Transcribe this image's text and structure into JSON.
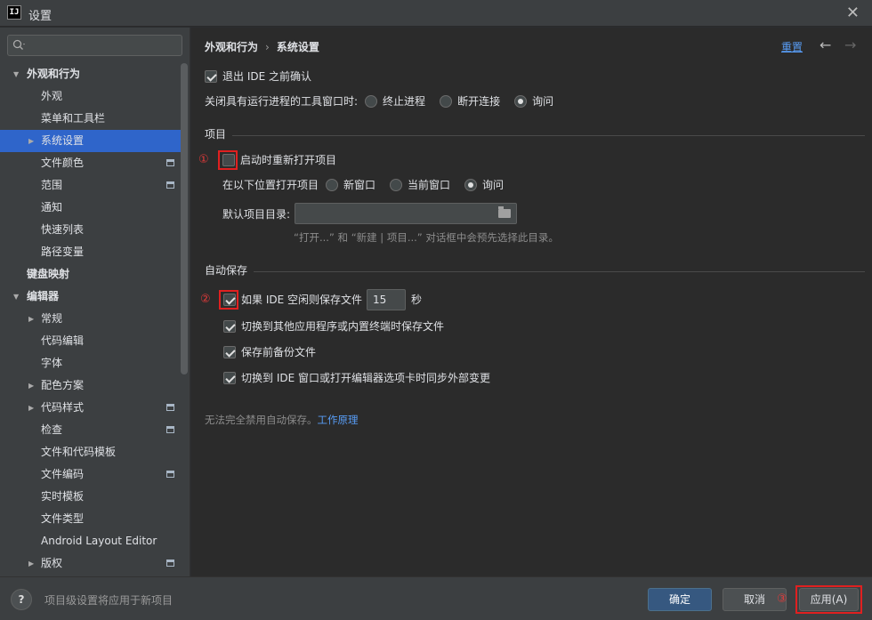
{
  "window": {
    "title": "设置",
    "app_icon": "IJ"
  },
  "sidebar": {
    "search_placeholder": "",
    "items": [
      {
        "label": "外观和行为",
        "level": 0,
        "expanded": true,
        "bold": true
      },
      {
        "label": "外观",
        "level": 1
      },
      {
        "label": "菜单和工具栏",
        "level": 1
      },
      {
        "label": "系统设置",
        "level": 1,
        "collapsed": true,
        "selected": true
      },
      {
        "label": "文件颜色",
        "level": 1,
        "project": true
      },
      {
        "label": "范围",
        "level": 1,
        "project": true
      },
      {
        "label": "通知",
        "level": 1
      },
      {
        "label": "快速列表",
        "level": 1
      },
      {
        "label": "路径变量",
        "level": 1
      },
      {
        "label": "键盘映射",
        "level": 0,
        "bold": true
      },
      {
        "label": "编辑器",
        "level": 0,
        "expanded": true,
        "bold": true
      },
      {
        "label": "常规",
        "level": 1,
        "collapsed": true
      },
      {
        "label": "代码编辑",
        "level": 1
      },
      {
        "label": "字体",
        "level": 1
      },
      {
        "label": "配色方案",
        "level": 1,
        "collapsed": true
      },
      {
        "label": "代码样式",
        "level": 1,
        "collapsed": true,
        "project": true
      },
      {
        "label": "检查",
        "level": 1,
        "project": true
      },
      {
        "label": "文件和代码模板",
        "level": 1
      },
      {
        "label": "文件编码",
        "level": 1,
        "project": true
      },
      {
        "label": "实时模板",
        "level": 1
      },
      {
        "label": "文件类型",
        "level": 1
      },
      {
        "label": "Android Layout Editor",
        "level": 1
      },
      {
        "label": "版权",
        "level": 1,
        "collapsed": true,
        "project": true
      }
    ]
  },
  "header": {
    "breadcrumb_parent": "外观和行为",
    "breadcrumb_sep": "›",
    "breadcrumb_current": "系统设置",
    "reset": "重置",
    "back_arrow": "←",
    "forward_arrow": "→"
  },
  "general": {
    "confirm_exit": "退出 IDE 之前确认",
    "confirm_exit_checked": true,
    "close_tool_label": "关闭具有运行进程的工具窗口时:",
    "close_options": [
      "终止进程",
      "断开连接",
      "询问"
    ],
    "close_selected": 2
  },
  "project": {
    "title": "项目",
    "reopen_marker": "①",
    "reopen_label": "启动时重新打开项目",
    "reopen_checked": false,
    "open_in_label": "在以下位置打开项目",
    "open_options": [
      "新窗口",
      "当前窗口",
      "询问"
    ],
    "open_selected": 2,
    "default_dir_label": "默认项目目录:",
    "default_dir_value": "",
    "default_dir_hint": "“打开...” 和 “新建 | 项目...” 对话框中会预先选择此目录。"
  },
  "autosave": {
    "title": "自动保存",
    "idle_marker": "②",
    "idle_label": "如果 IDE 空闲则保存文件",
    "idle_checked": true,
    "idle_seconds": "15",
    "idle_unit": "秒",
    "switch_app_label": "切换到其他应用程序或内置终端时保存文件",
    "backup_label": "保存前备份文件",
    "sync_label": "切换到 IDE 窗口或打开编辑器选项卡时同步外部变更",
    "note": "无法完全禁用自动保存。",
    "note_link": "工作原理"
  },
  "footer": {
    "help": "?",
    "note": "项目级设置将应用于新项目",
    "ok": "确定",
    "cancel": "取消",
    "apply_marker": "③",
    "apply": "应用(A)"
  }
}
